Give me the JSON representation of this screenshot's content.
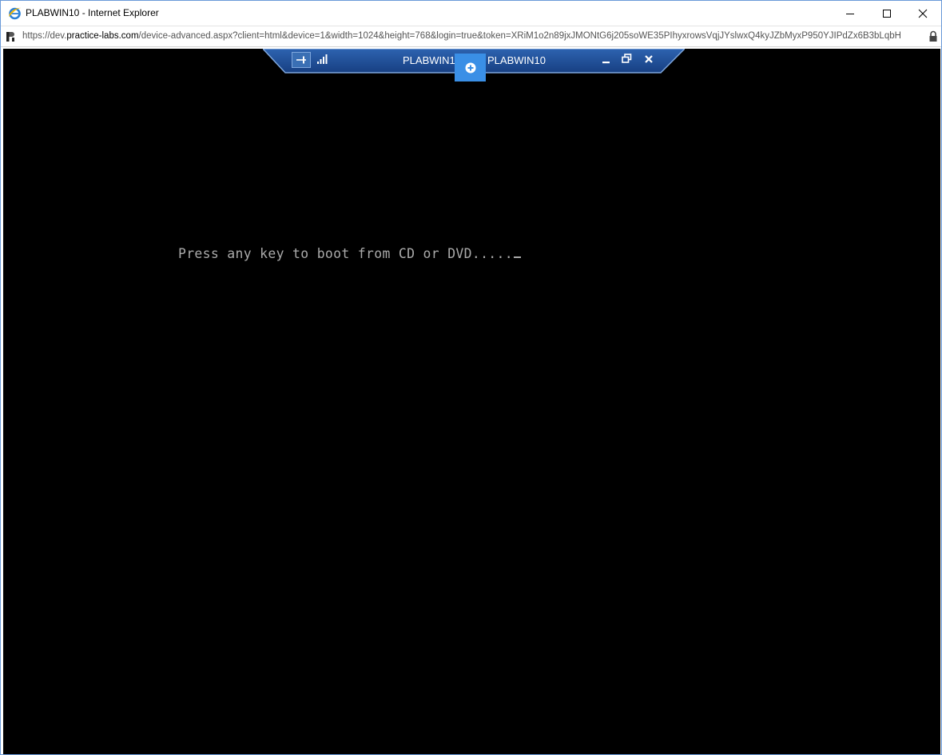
{
  "window": {
    "title": "PLABWIN10 - Internet Explorer",
    "icon": "internet-explorer-icon",
    "controls": [
      "minimize-icon",
      "maximize-icon",
      "close-icon"
    ]
  },
  "address_bar": {
    "url_scheme": "https://dev.",
    "url_host": "practice-labs.com",
    "url_path": "/device-advanced.aspx?client=html&device=1&width=1024&height=768&login=true&token=XRiM1o2n89jxJMONtG6j205soWE35PIhyxrowsVqjJYslwxQ4kyJZbMyxP950YJIPdZx6B3bLqbH",
    "secure_icon": "lock-icon",
    "site_icon": "practice-labs-favicon"
  },
  "remote_session": {
    "connection_bar": {
      "pin_icon": "pin-icon",
      "signal_icon": "signal-strength-icon",
      "name_left": "PLABWIN10",
      "name_right": "PLABWIN10",
      "add_icon": "plus-circle-icon"
    },
    "console_text": "Press any key to boot from CD or DVD.....",
    "colors": {
      "screen_bg": "#000000",
      "console_text": "#aaaaaa",
      "connbar": "#1f4f9a",
      "plus_button": "#3a8fe6"
    }
  }
}
